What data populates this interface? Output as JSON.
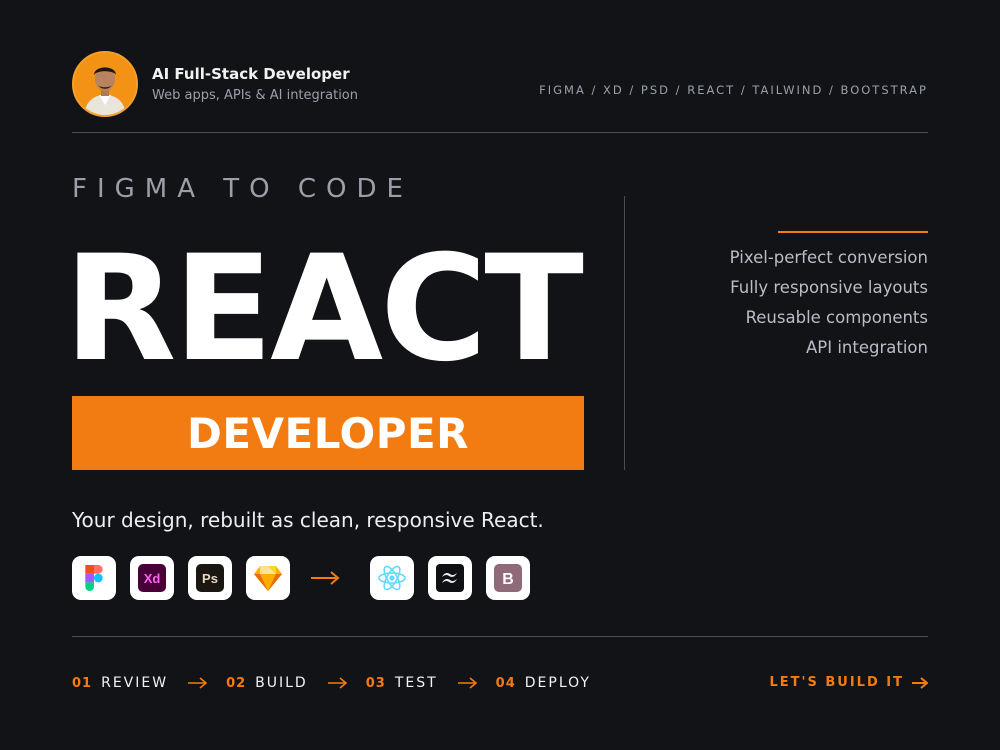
{
  "profile": {
    "name": "AI Full-Stack Developer",
    "tagline": "Web apps, APIs & AI integration"
  },
  "tech_list": "FIGMA / XD / PSD / REACT / TAILWIND / BOOTSTRAP",
  "hero": {
    "eyebrow": "FIGMA TO CODE",
    "title": "REACT",
    "band": "DEVELOPER",
    "subtitle": "Your design, rebuilt as clean, responsive React."
  },
  "features": [
    "Pixel-perfect conversion",
    "Fully responsive layouts",
    "Reusable components",
    "API integration"
  ],
  "tools": {
    "sources": [
      {
        "name": "figma-icon"
      },
      {
        "name": "xd-icon",
        "label": "Xd"
      },
      {
        "name": "photoshop-icon",
        "label": "Ps"
      },
      {
        "name": "sketch-icon"
      }
    ],
    "arrow": "arrow-right-icon",
    "targets": [
      {
        "name": "react-icon"
      },
      {
        "name": "tailwind-icon"
      },
      {
        "name": "bootstrap-icon",
        "label": "B"
      }
    ]
  },
  "steps": [
    {
      "num": "01",
      "label": "REVIEW"
    },
    {
      "num": "02",
      "label": "BUILD"
    },
    {
      "num": "03",
      "label": "TEST"
    },
    {
      "num": "04",
      "label": "DEPLOY"
    }
  ],
  "cta": {
    "label": "LET'S BUILD IT"
  },
  "colors": {
    "background": "#121317",
    "accent": "#f27c12",
    "muted_text": "#9aa0aa",
    "divider": "#4a4d55"
  }
}
